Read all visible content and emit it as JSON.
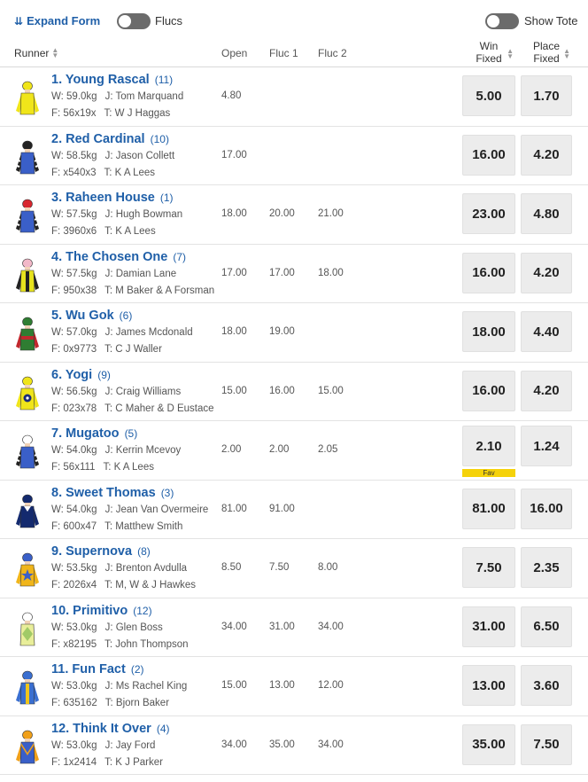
{
  "controls": {
    "expand_label": "Expand Form",
    "flucs_label": "Flucs",
    "tote_label": "Show Tote"
  },
  "columns": {
    "runner": "Runner",
    "open": "Open",
    "fluc1": "Fluc 1",
    "fluc2": "Fluc 2",
    "win_line1": "Win",
    "win_line2": "Fixed",
    "place_line1": "Place",
    "place_line2": "Fixed"
  },
  "runners": [
    {
      "name": "1. Young Rascal",
      "barrier": "(11)",
      "weight": "W: 59.0kg",
      "jockey": "J: Tom Marquand",
      "form": "F: 56x19x",
      "trainer": "T: W J Haggas",
      "open": "4.80",
      "fluc1": "",
      "fluc2": "",
      "win": "5.00",
      "place": "1.70",
      "fav": "",
      "silk": {
        "body": "#f0e51a",
        "sleeve": "#f0e51a",
        "cap": "#f0e51a",
        "pattern": "plain",
        "accent": "#f0e51a"
      }
    },
    {
      "name": "2. Red Cardinal",
      "barrier": "(10)",
      "weight": "W: 58.5kg",
      "jockey": "J: Jason Collett",
      "form": "F: x540x3",
      "trainer": "T: K A Lees",
      "open": "17.00",
      "fluc1": "",
      "fluc2": "",
      "win": "16.00",
      "place": "4.20",
      "fav": "",
      "silk": {
        "body": "#3a5fc8",
        "sleeve": "#222222",
        "cap": "#222222",
        "pattern": "check-sleeves",
        "accent": "#ffffff"
      }
    },
    {
      "name": "3. Raheen House",
      "barrier": "(1)",
      "weight": "W: 57.5kg",
      "jockey": "J: Hugh Bowman",
      "form": "F: 3960x6",
      "trainer": "T: K A Lees",
      "open": "18.00",
      "fluc1": "20.00",
      "fluc2": "21.00",
      "win": "23.00",
      "place": "4.80",
      "fav": "",
      "silk": {
        "body": "#3a5fc8",
        "sleeve": "#222222",
        "cap": "#d8262e",
        "pattern": "check-sleeves",
        "accent": "#ffffff"
      }
    },
    {
      "name": "4. The Chosen One",
      "barrier": "(7)",
      "weight": "W: 57.5kg",
      "jockey": "J: Damian Lane",
      "form": "F: 950x38",
      "trainer": "T: M Baker & A Forsman",
      "open": "17.00",
      "fluc1": "17.00",
      "fluc2": "18.00",
      "win": "16.00",
      "place": "4.20",
      "fav": "",
      "silk": {
        "body": "#e6e21e",
        "sleeve": "#222222",
        "cap": "#f2b8c8",
        "pattern": "stripe",
        "accent": "#222222"
      }
    },
    {
      "name": "5. Wu Gok",
      "barrier": "(6)",
      "weight": "W: 57.0kg",
      "jockey": "J: James Mcdonald",
      "form": "F: 0x9773",
      "trainer": "T: C J Waller",
      "open": "18.00",
      "fluc1": "19.00",
      "fluc2": "",
      "win": "18.00",
      "place": "4.40",
      "fav": "",
      "silk": {
        "body": "#2f7d32",
        "sleeve": "#c0282d",
        "cap": "#2f7d32",
        "pattern": "band",
        "accent": "#c0282d"
      }
    },
    {
      "name": "6. Yogi",
      "barrier": "(9)",
      "weight": "W: 56.5kg",
      "jockey": "J: Craig Williams",
      "form": "F: 023x78",
      "trainer": "T: C Maher & D Eustace",
      "open": "15.00",
      "fluc1": "16.00",
      "fluc2": "15.00",
      "win": "16.00",
      "place": "4.20",
      "fav": "",
      "silk": {
        "body": "#f0e51a",
        "sleeve": "#f0e51a",
        "cap": "#f0e51a",
        "pattern": "emblem",
        "accent": "#1a2a7a"
      }
    },
    {
      "name": "7. Mugatoo",
      "barrier": "(5)",
      "weight": "W: 54.0kg",
      "jockey": "J: Kerrin Mcevoy",
      "form": "F: 56x111",
      "trainer": "T: K A Lees",
      "open": "2.00",
      "fluc1": "2.00",
      "fluc2": "2.05",
      "win": "2.10",
      "place": "1.24",
      "fav": "Fav",
      "silk": {
        "body": "#3a5fc8",
        "sleeve": "#222222",
        "cap": "#ffffff",
        "pattern": "check-sleeves",
        "accent": "#ffffff"
      }
    },
    {
      "name": "8. Sweet Thomas",
      "barrier": "(3)",
      "weight": "W: 54.0kg",
      "jockey": "J: Jean Van Overmeire",
      "form": "F: 600x47",
      "trainer": "T: Matthew Smith",
      "open": "81.00",
      "fluc1": "91.00",
      "fluc2": "",
      "win": "81.00",
      "place": "16.00",
      "fav": "",
      "silk": {
        "body": "#142a6e",
        "sleeve": "#142a6e",
        "cap": "#142a6e",
        "pattern": "collar",
        "accent": "#ffffff"
      }
    },
    {
      "name": "9. Supernova",
      "barrier": "(8)",
      "weight": "W: 53.5kg",
      "jockey": "J: Brenton Avdulla",
      "form": "F: 2026x4",
      "trainer": "T: M, W & J Hawkes",
      "open": "8.50",
      "fluc1": "7.50",
      "fluc2": "8.00",
      "win": "7.50",
      "place": "2.35",
      "fav": "",
      "silk": {
        "body": "#f0b51a",
        "sleeve": "#f0b51a",
        "cap": "#3a5fc8",
        "pattern": "star",
        "accent": "#3a5fc8"
      }
    },
    {
      "name": "10. Primitivo",
      "barrier": "(12)",
      "weight": "W: 53.0kg",
      "jockey": "J: Glen Boss",
      "form": "F: x82195",
      "trainer": "T: John Thompson",
      "open": "34.00",
      "fluc1": "31.00",
      "fluc2": "34.00",
      "win": "31.00",
      "place": "6.50",
      "fav": "",
      "silk": {
        "body": "#e9ee9a",
        "sleeve": "#ffffff",
        "cap": "#ffffff",
        "pattern": "diamond",
        "accent": "#8fc05a"
      }
    },
    {
      "name": "11. Fun Fact",
      "barrier": "(2)",
      "weight": "W: 53.0kg",
      "jockey": "J: Ms Rachel King",
      "form": "F: 635162",
      "trainer": "T: Bjorn Baker",
      "open": "15.00",
      "fluc1": "13.00",
      "fluc2": "12.00",
      "win": "13.00",
      "place": "3.60",
      "fav": "",
      "silk": {
        "body": "#3a6fd0",
        "sleeve": "#3a6fd0",
        "cap": "#3a6fd0",
        "pattern": "stripe",
        "accent": "#f0c51a"
      }
    },
    {
      "name": "12. Think It Over",
      "barrier": "(4)",
      "weight": "W: 53.0kg",
      "jockey": "J: Jay Ford",
      "form": "F: 1x2414",
      "trainer": "T: K J Parker",
      "open": "34.00",
      "fluc1": "35.00",
      "fluc2": "34.00",
      "win": "35.00",
      "place": "7.50",
      "fav": "",
      "silk": {
        "body": "#3a5fc8",
        "sleeve": "#f0a01a",
        "cap": "#f0a01a",
        "pattern": "vee",
        "accent": "#f0a01a"
      }
    }
  ]
}
